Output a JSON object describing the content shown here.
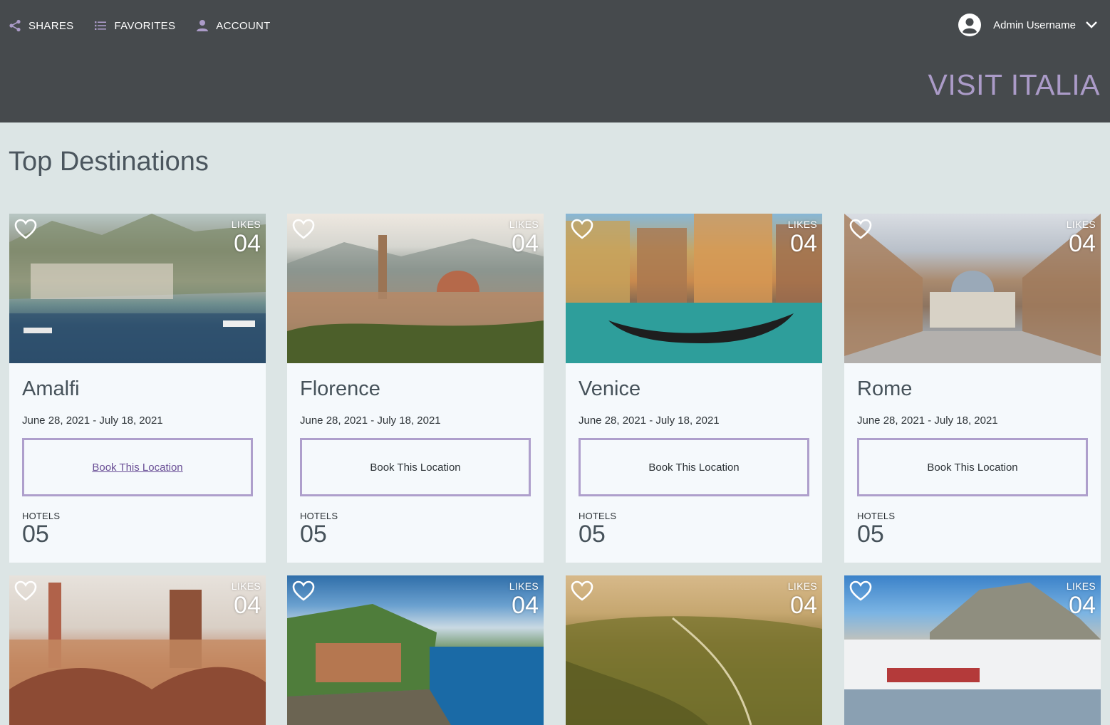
{
  "nav": {
    "shares": "SHARES",
    "favorites": "FAVORITES",
    "account": "ACCOUNT"
  },
  "user": {
    "name": "Admin Username"
  },
  "brand": "VISIT ITALIA",
  "section_title": "Top Destinations",
  "cards": [
    {
      "name": "Amalfi",
      "dates": "June 28, 2021 - July 18, 2021",
      "book_label": "Book This Location",
      "likes_label": "LIKES",
      "likes": "04",
      "hotels_label": "HOTELS",
      "hotels": "05"
    },
    {
      "name": "Florence",
      "dates": "June 28, 2021 - July 18, 2021",
      "book_label": "Book This Location",
      "likes_label": "LIKES",
      "likes": "04",
      "hotels_label": "HOTELS",
      "hotels": "05"
    },
    {
      "name": "Venice",
      "dates": "June 28, 2021 - July 18, 2021",
      "book_label": "Book This Location",
      "likes_label": "LIKES",
      "likes": "04",
      "hotels_label": "HOTELS",
      "hotels": "05"
    },
    {
      "name": "Rome",
      "dates": "June 28, 2021 - July 18, 2021",
      "book_label": "Book This Location",
      "likes_label": "LIKES",
      "likes": "04",
      "hotels_label": "HOTELS",
      "hotels": "05"
    },
    {
      "likes_label": "LIKES",
      "likes": "04"
    },
    {
      "likes_label": "LIKES",
      "likes": "04"
    },
    {
      "likes_label": "LIKES",
      "likes": "04"
    },
    {
      "likes_label": "LIKES",
      "likes": "04"
    }
  ],
  "colors": {
    "header_bg": "#464a4d",
    "page_bg": "#dce5e5",
    "accent": "#ab9bc8",
    "button_border": "#ae9fcc",
    "link_active": "#6a4f96"
  },
  "icons": [
    "share-icon",
    "list-icon",
    "person-icon",
    "account-circle-icon",
    "chevron-down-icon",
    "heart-outline-icon"
  ]
}
